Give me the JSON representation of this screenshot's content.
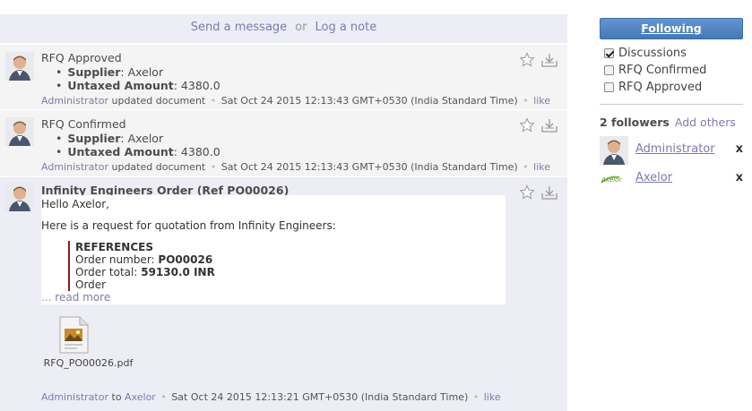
{
  "composer": {
    "send_message": "Send a message",
    "or": "or",
    "log_note": "Log a note"
  },
  "messages": [
    {
      "title": "RFQ Approved",
      "fields": [
        {
          "label": "Supplier",
          "value": "Axelor"
        },
        {
          "label": "Untaxed Amount",
          "value": "4380.0"
        }
      ],
      "author": "Administrator",
      "action": "updated document",
      "date": "Sat Oct 24 2015 12:13:43 GMT+0530 (India Standard Time)",
      "like": "like"
    },
    {
      "title": "RFQ Confirmed",
      "fields": [
        {
          "label": "Supplier",
          "value": "Axelor"
        },
        {
          "label": "Untaxed Amount",
          "value": "4380.0"
        }
      ],
      "author": "Administrator",
      "action": "updated document",
      "date": "Sat Oct 24 2015 12:13:43 GMT+0530 (India Standard Time)",
      "like": "like"
    },
    {
      "title": "Infinity Engineers Order (Ref PO00026)",
      "greeting": "Hello Axelor,",
      "intro": "Here is a request for quotation from Infinity Engineers:",
      "ref_heading": "REFERENCES",
      "order_number_label": "Order number:",
      "order_number": "PO00026",
      "order_total_label": "Order total:",
      "order_total": "59130.0 INR",
      "truncated": "Order",
      "ellipsis": "...",
      "read_more": "read more",
      "attachment": "RFQ_PO00026.pdf",
      "author": "Administrator",
      "to": "to",
      "recipient": "Axelor",
      "date": "Sat Oct 24 2015 12:13:21 GMT+0530 (India Standard Time)",
      "like": "like"
    }
  ],
  "sidebar": {
    "follow_button": "Following",
    "subtypes": [
      {
        "label": "Discussions",
        "checked": true
      },
      {
        "label": "RFQ Confirmed",
        "checked": false
      },
      {
        "label": "RFQ Approved",
        "checked": false
      }
    ],
    "followers_count": "2 followers",
    "add_others": "Add others",
    "followers": [
      {
        "name": "Administrator",
        "remove": "x"
      },
      {
        "name": "Axelor",
        "remove": "x",
        "logo_text": "Axelor"
      }
    ]
  }
}
